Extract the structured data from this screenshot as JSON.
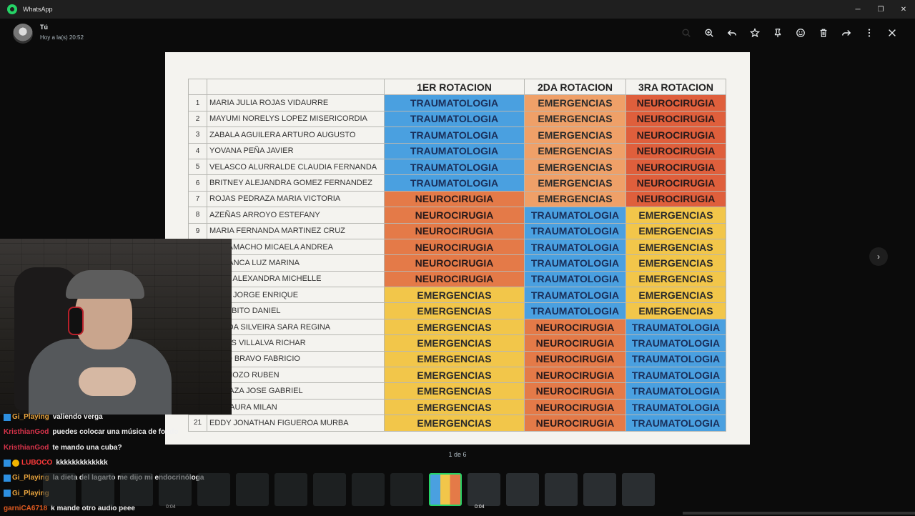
{
  "window": {
    "title": "WhatsApp",
    "controls": [
      "minimize",
      "restore",
      "close"
    ]
  },
  "header": {
    "sender": "Tú",
    "time": "Hoy a la(s) 20:52",
    "actions": [
      "search-icon",
      "zoom-icon",
      "reply-icon",
      "star-icon",
      "pin-icon",
      "emoji-icon",
      "delete-icon",
      "forward-icon",
      "more-icon",
      "close-icon"
    ]
  },
  "schedule": {
    "headers": [
      "",
      "",
      "1ER ROTACION",
      "2DA ROTACION",
      "3RA ROTACION"
    ],
    "rows": [
      {
        "n": "1",
        "name": "MARIA JULIA ROJAS VIDAURRE",
        "r1": "TRAUMATOLOGIA",
        "r2": "EMERGENCIAS",
        "r3": "NEUROCIRUGIA"
      },
      {
        "n": "2",
        "name": "MAYUMI NORELYS LOPEZ MISERICORDIA",
        "r1": "TRAUMATOLOGIA",
        "r2": "EMERGENCIAS",
        "r3": "NEUROCIRUGIA"
      },
      {
        "n": "3",
        "name": "ZABALA AGUILERA ARTURO AUGUSTO",
        "r1": "TRAUMATOLOGIA",
        "r2": "EMERGENCIAS",
        "r3": "NEUROCIRUGIA"
      },
      {
        "n": "4",
        "name": "YOVANA PEÑA JAVIER",
        "r1": "TRAUMATOLOGIA",
        "r2": "EMERGENCIAS",
        "r3": "NEUROCIRUGIA"
      },
      {
        "n": "5",
        "name": "VELASCO ALURRALDE CLAUDIA FERNANDA",
        "r1": "TRAUMATOLOGIA",
        "r2": "EMERGENCIAS",
        "r3": "NEUROCIRUGIA"
      },
      {
        "n": "6",
        "name": "BRITNEY ALEJANDRA GOMEZ FERNANDEZ",
        "r1": "TRAUMATOLOGIA",
        "r2": "EMERGENCIAS",
        "r3": "NEUROCIRUGIA"
      },
      {
        "n": "7",
        "name": "ROJAS PEDRAZA MARIA VICTORIA",
        "r1": "NEUROCIRUGIA",
        "r2": "EMERGENCIAS",
        "r3": "NEUROCIRUGIA"
      },
      {
        "n": "8",
        "name": "AZEÑAS ARROYO ESTEFANY",
        "r1": "NEUROCIRUGIA",
        "r2": "TRAUMATOLOGIA",
        "r3": "EMERGENCIAS"
      },
      {
        "n": "9",
        "name": "MARIA FERNANDA MARTINEZ CRUZ",
        "r1": "NEUROCIRUGIA",
        "r2": "TRAUMATOLOGIA",
        "r3": "EMERGENCIAS"
      },
      {
        "n": "",
        "name": "CA CAMACHO MICAELA ANDREA",
        "r1": "NEUROCIRUGIA",
        "r2": "TRAUMATOLOGIA",
        "r3": "EMERGENCIAS"
      },
      {
        "n": "",
        "name": "S HUANCA LUZ MARINA",
        "r1": "NEUROCIRUGIA",
        "r2": "TRAUMATOLOGIA",
        "r3": "EMERGENCIAS"
      },
      {
        "n": "",
        "name": "AZOS ALEXANDRA MICHELLE",
        "r1": "NEUROCIRUGIA",
        "r2": "TRAUMATOLOGIA",
        "r3": "EMERGENCIAS"
      },
      {
        "n": "",
        "name": "VEGA JORGE ENRIQUE",
        "r1": "EMERGENCIAS",
        "r2": "TRAUMATOLOGIA",
        "r3": "EMERGENCIAS"
      },
      {
        "n": "",
        "name": "GARABITO DANIEL",
        "r1": "EMERGENCIAS",
        "r2": "TRAUMATOLOGIA",
        "r3": "EMERGENCIAS"
      },
      {
        "n": "",
        "name": "OSA DA SILVEIRA SARA REGINA",
        "r1": "EMERGENCIAS",
        "r2": "NEUROCIRUGIA",
        "r3": "TRAUMATOLOGIA"
      },
      {
        "n": "",
        "name": "TEROS VILLALVA RICHAR",
        "r1": "EMERGENCIAS",
        "r2": "NEUROCIRUGIA",
        "r3": "TRAUMATOLOGIA"
      },
      {
        "n": "",
        "name": "RANO BRAVO FABRICIO",
        "r1": "EMERGENCIAS",
        "r2": "NEUROCIRUGIA",
        "r3": "TRAUMATOLOGIA"
      },
      {
        "n": "",
        "name": "S PANOZO RUBEN",
        "r1": "EMERGENCIAS",
        "r2": "NEUROCIRUGIA",
        "r3": "TRAUMATOLOGIA"
      },
      {
        "n": "",
        "name": "NI APAZA JOSE GABRIEL",
        "r1": "EMERGENCIAS",
        "r2": "NEUROCIRUGIA",
        "r3": "TRAUMATOLOGIA"
      },
      {
        "n": "",
        "name": "LIA MAURA MILAN",
        "r1": "EMERGENCIAS",
        "r2": "NEUROCIRUGIA",
        "r3": "TRAUMATOLOGIA"
      },
      {
        "n": "21",
        "name": "EDDY JONATHAN FIGUEROA MURBA",
        "r1": "EMERGENCIAS",
        "r2": "NEUROCIRUGIA",
        "r3": "TRAUMATOLOGIA"
      }
    ]
  },
  "chat": [
    {
      "user": "Gi_Playing",
      "color": "#e8a33d",
      "msg": "valiendo verga",
      "badge": true
    },
    {
      "user": "KristhianGod",
      "color": "#d6334a",
      "msg": "puedes colocar una música de fondo"
    },
    {
      "user": "KristhianGod",
      "color": "#d6334a",
      "msg": "te mando una cuba?"
    },
    {
      "user": "LUBOCO",
      "color": "#ff3b3b",
      "msg": "kkkkkkkkkkkkk",
      "badge": true,
      "badge2": true
    },
    {
      "user": "Gi_Playing",
      "color": "#e8a33d",
      "msg": "la dieta del lagarto me dijo mi endocrinóloga",
      "badge": true
    },
    {
      "user": "Gi_Playing",
      "color": "#e8a33d",
      "msg": "",
      "badge": true
    },
    {
      "user": "garniCA6718",
      "color": "#e05a20",
      "msg": "k mande otro audio peee"
    }
  ],
  "viewer": {
    "counter": "1 de 6"
  },
  "thumbnails": [
    {
      "kind": "photo"
    },
    {
      "kind": "photo"
    },
    {
      "kind": "photo"
    },
    {
      "kind": "photo",
      "duration": "0:04"
    },
    {
      "kind": "photo"
    },
    {
      "kind": "photo"
    },
    {
      "kind": "photo"
    },
    {
      "kind": "photo"
    },
    {
      "kind": "photo"
    },
    {
      "kind": "photo"
    },
    {
      "kind": "photo",
      "active": true
    },
    {
      "kind": "video",
      "duration": "0:04",
      "bright": true
    },
    {
      "kind": "photo",
      "bright": true
    },
    {
      "kind": "photo",
      "bright": true
    },
    {
      "kind": "photo",
      "bright": true
    },
    {
      "kind": "photo",
      "bright": true
    }
  ]
}
